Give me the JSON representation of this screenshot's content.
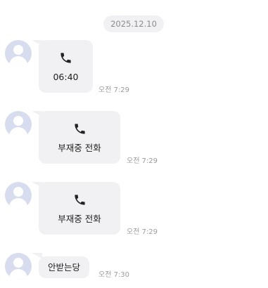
{
  "date_divider": "2025.12.10",
  "messages": [
    {
      "type": "call",
      "text": "06:40",
      "time": "오전 7:29"
    },
    {
      "type": "call",
      "text": "부재중 전화",
      "time": "오전 7:29"
    },
    {
      "type": "call",
      "text": "부재중 전화",
      "time": "오전 7:29"
    },
    {
      "type": "text",
      "text": "안받는당",
      "time": "오전 7:30"
    }
  ],
  "icons": {
    "phone": "phone-icon",
    "avatar": "default-profile-avatar"
  },
  "colors": {
    "bubble": "#f1f1f3",
    "avatar": "#d7dcef",
    "time_text": "#9b9b9b",
    "date_pill": "#f1f1f3"
  }
}
